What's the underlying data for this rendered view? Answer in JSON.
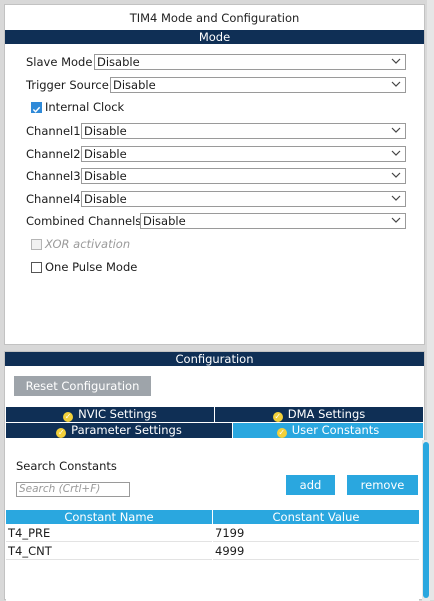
{
  "mode_panel": {
    "title": "TIM4 Mode and Configuration",
    "section_mode": "Mode",
    "slave_mode": {
      "label": "Slave Mode",
      "value": "Disable"
    },
    "trigger_source": {
      "label": "Trigger Source",
      "value": "Disable"
    },
    "internal_clock": {
      "label": "Internal Clock",
      "checked": true
    },
    "channel1": {
      "label": "Channel1",
      "value": "Disable"
    },
    "channel2": {
      "label": "Channel2",
      "value": "Disable"
    },
    "channel3": {
      "label": "Channel3",
      "value": "Disable"
    },
    "channel4": {
      "label": "Channel4",
      "value": "Disable"
    },
    "combined_channels": {
      "label": "Combined Channels",
      "value": "Disable"
    },
    "xor_activation": {
      "label": "XOR activation",
      "checked": false,
      "disabled": true
    },
    "one_pulse_mode": {
      "label": "One Pulse Mode",
      "checked": false
    }
  },
  "config_panel": {
    "section_title": "Configuration",
    "reset_button": "Reset Configuration",
    "tabs": [
      {
        "label": "NVIC Settings",
        "active": false
      },
      {
        "label": "DMA Settings",
        "active": false
      },
      {
        "label": "Parameter Settings",
        "active": false
      },
      {
        "label": "User Constants",
        "active": true
      }
    ],
    "search_label": "Search Constants",
    "search_placeholder": "Search (Crtl+F)",
    "add_button": "add",
    "remove_button": "remove",
    "table": {
      "columns": [
        "Constant Name",
        "Constant Value"
      ],
      "rows": [
        [
          "T4_PRE",
          "7199"
        ],
        [
          "T4_CNT",
          "4999"
        ]
      ]
    }
  },
  "colors": {
    "header_dark": "#0f2f55",
    "accent_blue": "#2aa7df",
    "check_yellow": "#f2d03a"
  }
}
